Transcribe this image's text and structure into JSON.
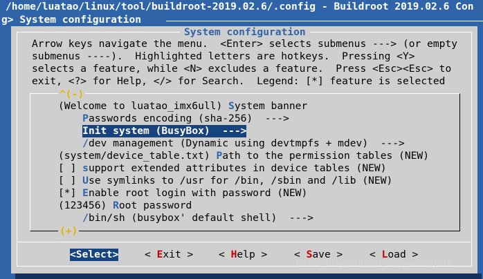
{
  "window": {
    "title": "/home/luatao/linux/tool/buildroot-2019.02.6/.config - Buildroot 2019.02.6 Con",
    "breadcrumb": "g> System configuration"
  },
  "dialog": {
    "title": "System configuration",
    "help_lines": [
      "Arrow keys navigate the menu.  <Enter> selects submenus ---> (or empty",
      "submenus ----).  Highlighted letters are hotkeys.  Pressing <Y>",
      "selects a feature, while <N> excludes a feature.  Press <Esc><Esc> to",
      "exit, <?> for Help, </> for Search.  Legend: [*] feature is selected"
    ],
    "scroll_up": "^(-)",
    "scroll_down": "(+)"
  },
  "menu": [
    {
      "pre": "(Welcome to luatao_imx6ull) ",
      "hot": "S",
      "post": "ystem banner"
    },
    {
      "pre": "    ",
      "hot": "P",
      "post": "asswords encoding (sha-256)  --->"
    },
    {
      "pre": "    ",
      "hot": "I",
      "post": "nit system (BusyBox)  --->"
    },
    {
      "pre": "    ",
      "hot": "/",
      "post": "dev management (Dynamic using devtmpfs + mdev)  --->"
    },
    {
      "pre": "(system/device_table.txt) ",
      "hot": "P",
      "post": "ath to the permission tables (NEW)"
    },
    {
      "pre": "[ ] ",
      "hot": "s",
      "post": "upport extended attributes in device tables (NEW)"
    },
    {
      "pre": "[ ] ",
      "hot": "U",
      "post": "se symlinks to /usr for /bin, /sbin and /lib (NEW)"
    },
    {
      "pre": "[*] ",
      "hot": "E",
      "post": "nable root login with password (NEW)"
    },
    {
      "pre": "(123456) ",
      "hot": "R",
      "post": "oot password"
    },
    {
      "pre": "    ",
      "hot": "/",
      "post": "bin/sh (busybox' default shell)  --->"
    }
  ],
  "buttons": [
    {
      "pre": "<",
      "hot": "S",
      "post": "elect>"
    },
    {
      "pre": "< ",
      "hot": "E",
      "post": "xit >"
    },
    {
      "pre": "< ",
      "hot": "H",
      "post": "elp >"
    },
    {
      "pre": "< ",
      "hot": "S",
      "post": "ave >"
    },
    {
      "pre": "< ",
      "hot": "L",
      "post": "oad >"
    }
  ],
  "watermark": "https://blog.csdn.net/lengyuefeng212"
}
